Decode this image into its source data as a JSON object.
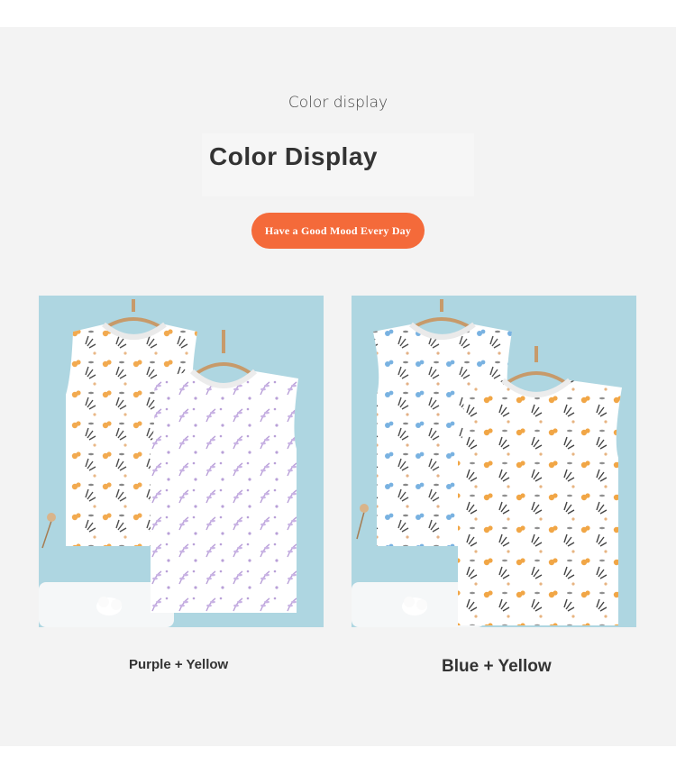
{
  "page": {
    "subtitle": "Color display",
    "title": "Color Display",
    "tagline": "Have a Good Mood Every Day",
    "colors": {
      "page_bg": "#f3f3f3",
      "accent": "#f46a3a",
      "photo_bg": "#a9d3df",
      "text": "#333333"
    }
  },
  "products": [
    {
      "caption": "Purple + Yellow",
      "image": "two-vests-purple-yellow-print",
      "vests": [
        "yellow-floral-print",
        "purple-leaf-print"
      ]
    },
    {
      "caption": "Blue + Yellow",
      "image": "two-vests-blue-yellow-print",
      "vests": [
        "blue-floral-print",
        "yellow-floral-print"
      ]
    }
  ]
}
